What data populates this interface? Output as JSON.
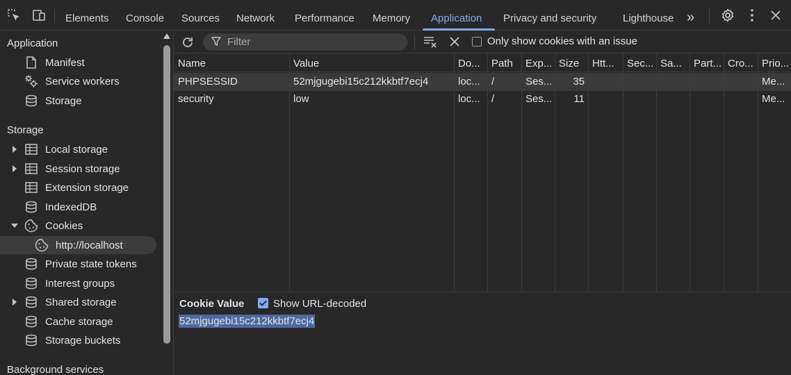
{
  "toolbar": {
    "tabs": [
      "Elements",
      "Console",
      "Sources",
      "Network",
      "Performance",
      "Memory",
      "Application",
      "Privacy and security",
      "Lighthouse"
    ],
    "active_tab": "Application",
    "more_tabs": "»"
  },
  "sidebar": {
    "application_header": "Application",
    "application_items": [
      "Manifest",
      "Service workers",
      "Storage"
    ],
    "storage_header": "Storage",
    "storage_items": [
      "Local storage",
      "Session storage",
      "Extension storage",
      "IndexedDB",
      "Cookies",
      "http://localhost",
      "Private state tokens",
      "Interest groups",
      "Shared storage",
      "Cache storage",
      "Storage buckets"
    ],
    "background_header": "Background services"
  },
  "cookies_toolbar": {
    "filter_placeholder": "Filter",
    "only_issues_label": "Only show cookies with an issue",
    "only_issues_checked": false
  },
  "table": {
    "columns": [
      "Name",
      "Value",
      "Do...",
      "Path",
      "Exp...",
      "Size",
      "Htt...",
      "Sec...",
      "Sa...",
      "Part...",
      "Cro...",
      "Prio..."
    ],
    "rows": [
      {
        "name": "PHPSESSID",
        "value": "52mjgugebi15c212kkbtf7ecj4",
        "domain": "loc...",
        "path": "/",
        "expires": "Ses...",
        "size": "35",
        "priority": "Me...",
        "selected": true
      },
      {
        "name": "security",
        "value": "low",
        "domain": "loc...",
        "path": "/",
        "expires": "Ses...",
        "size": "11",
        "priority": "Me...",
        "selected": false
      }
    ]
  },
  "value_pane": {
    "title": "Cookie Value",
    "url_decoded_label": "Show URL-decoded",
    "url_decoded_checked": true,
    "value": "52mjgugebi15c212kkbtf7ecj4"
  },
  "colors": {
    "accent": "#7cacf8",
    "background": "#282828",
    "selection": "#4d6a9e"
  }
}
